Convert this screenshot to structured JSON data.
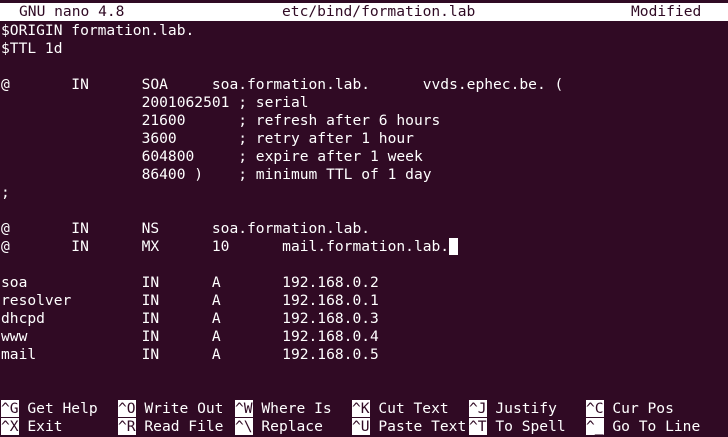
{
  "titlebar": {
    "app": "GNU nano 4.8",
    "filename": "etc/bind/formation.lab",
    "status": "Modified"
  },
  "file_lines": [
    "$ORIGIN formation.lab.",
    "$TTL 1d",
    "",
    "@       IN      SOA     soa.formation.lab.      vvds.ephec.be. (",
    "                2001062501 ; serial",
    "                21600      ; refresh after 6 hours",
    "                3600       ; retry after 1 hour",
    "                604800     ; expire after 1 week",
    "                86400 )    ; minimum TTL of 1 day",
    ";",
    "",
    "@       IN      NS      soa.formation.lab.",
    "@       IN      MX      10      mail.formation.lab.",
    "",
    "soa             IN      A       192.168.0.2",
    "resolver        IN      A       192.168.0.1",
    "dhcpd           IN      A       192.168.0.3",
    "www             IN      A       192.168.0.4",
    "mail            IN      A       192.168.0.5"
  ],
  "shortcuts": {
    "row1": [
      {
        "key": "^G",
        "label": "Get Help"
      },
      {
        "key": "^O",
        "label": "Write Out"
      },
      {
        "key": "^W",
        "label": "Where Is"
      },
      {
        "key": "^K",
        "label": "Cut Text"
      },
      {
        "key": "^J",
        "label": "Justify"
      },
      {
        "key": "^C",
        "label": "Cur Pos"
      }
    ],
    "row2": [
      {
        "key": "^X",
        "label": "Exit"
      },
      {
        "key": "^R",
        "label": "Read File"
      },
      {
        "key": "^\\",
        "label": "Replace"
      },
      {
        "key": "^U",
        "label": "Paste Text"
      },
      {
        "key": "^T",
        "label": "To Spell"
      },
      {
        "key": "^_",
        "label": "Go To Line"
      }
    ]
  }
}
